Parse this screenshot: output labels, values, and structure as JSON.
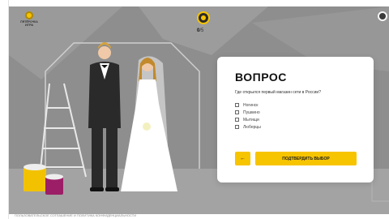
{
  "brand": {
    "logo_name": "ПЯТЁРОЧКА",
    "logo_sub": "ИГРА"
  },
  "header": {
    "score": "0",
    "score_total": "/5"
  },
  "question": {
    "title": "ВОПРОС",
    "text": "Где открылся первый магазин сети в России?",
    "options": [
      "Ногинск",
      "Пушкино",
      "Мытищи",
      "Люберцы"
    ]
  },
  "buttons": {
    "back_label": "←",
    "confirm_label": "ПОДТВЕРДИТЬ ВЫБОР"
  },
  "footer": {
    "text": "ПОЛЬЗОВАТЕЛЬСКОЕ СОГЛАШЕНИЕ И ПОЛИТИКА КОНФИДЕНЦИАЛЬНОСТИ"
  },
  "colors": {
    "accent": "#f7c400",
    "scene_bg": "#8e8e8e",
    "card_bg": "#ffffff"
  },
  "icons": [
    "logo-icon",
    "coin-icon",
    "settings-icon",
    "arrow-left-icon"
  ]
}
